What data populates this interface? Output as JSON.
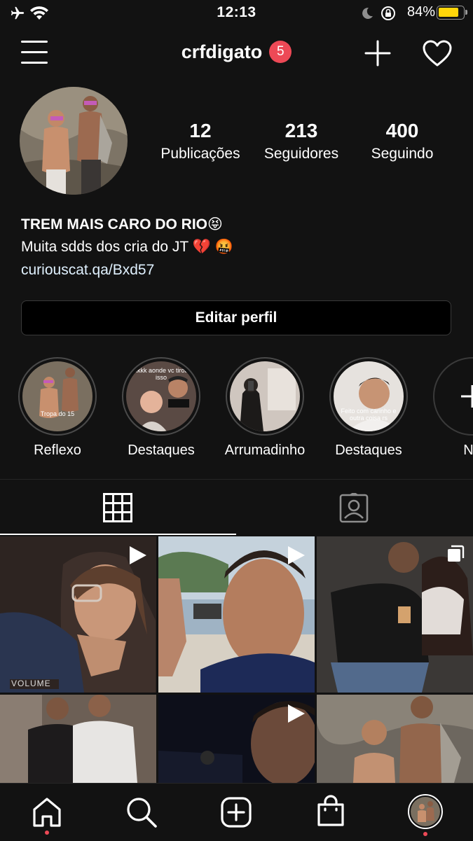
{
  "status_bar": {
    "time": "12:13",
    "battery_percent": "84%",
    "battery_level": 0.84,
    "battery_color": "#ffd60a"
  },
  "header": {
    "username": "crfdigato",
    "notification_count": "5",
    "badge_color": "#ed4956",
    "icons": [
      "menu-icon",
      "plus-icon",
      "heart-icon"
    ]
  },
  "profile": {
    "stats": [
      {
        "number": "12",
        "label": "Publicações"
      },
      {
        "number": "213",
        "label": "Seguidores"
      },
      {
        "number": "400",
        "label": "Seguindo"
      }
    ],
    "bio": {
      "name": "TREM MAIS CARO DO RIO😝",
      "line": "Muita sdds dos cria do JT 💔 🤬",
      "link": "curiouscat.qa/Bxd57"
    },
    "edit_button": "Editar perfil"
  },
  "highlights": [
    {
      "label": "Reflexo",
      "thumb_text": "Tropa do 15"
    },
    {
      "label": "Destaques",
      "thumb_text": "kkkk aonde vc tirou isso"
    },
    {
      "label": "Arrumadinho",
      "thumb_text": ""
    },
    {
      "label": "Destaques",
      "thumb_text": "Feito com carinho e outra coisa rs"
    },
    {
      "label": "No",
      "thumb_text": ""
    }
  ],
  "tabs": [
    "grid-icon",
    "tagged-icon"
  ],
  "grid": {
    "overlay_text": "VOLUME",
    "posts": [
      {
        "kind": "video"
      },
      {
        "kind": "video"
      },
      {
        "kind": "multiple"
      },
      {
        "kind": "photo"
      },
      {
        "kind": "video"
      },
      {
        "kind": "photo"
      }
    ]
  },
  "bottom_nav": [
    "home-icon",
    "search-icon",
    "new-post-icon",
    "shop-icon",
    "profile-avatar"
  ]
}
